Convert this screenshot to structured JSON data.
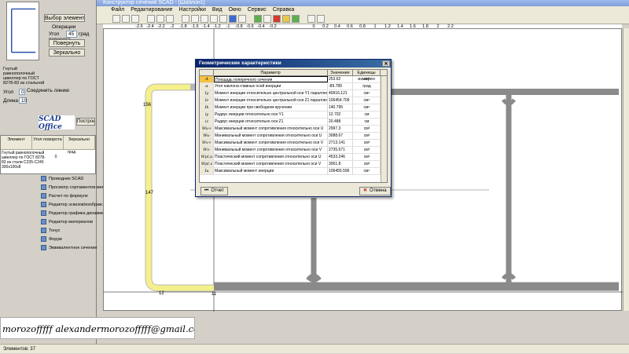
{
  "window": {
    "title": "Конструктор сечений SCAD - [Шаблон1]"
  },
  "menu": [
    "Файл",
    "Редактирование",
    "Настройки",
    "Вид",
    "Окно",
    "Сервис",
    "Справка"
  ],
  "left": {
    "select_button": "Выбор элемента",
    "operations_label": "Операции",
    "angle_label": "Угол поворота",
    "angle_value": "45",
    "angle_unit": "град",
    "rotate_button": "Повернуть",
    "mirror_button": "Зеркально",
    "profile_label": "Гнутый равнополочный швеллер по ГОСТ 8278-83 из стальной",
    "connect_label": "Соединить линию",
    "angle2_label": "Угол",
    "angle2_value": "0",
    "length_label": "Длина",
    "length_value": "10",
    "build_button": "Построить",
    "logo": "SCAD Office",
    "table_headers": [
      "Элемент",
      "Угол поворота",
      "Зеркально"
    ],
    "table_unit": "град",
    "table_row_name": "Гнутый равнополочный швеллер по ГОСТ 8278-83 из стали С235-С245 300х100х8",
    "table_row_angle": "0",
    "tree": [
      "Проводник SCAD",
      "Просмотр сортаментов метал",
      "Расчет по формуле",
      "Редактор эскизов/изображ.",
      "Редактор графика динамики",
      "Редактор материалов",
      "Тонус",
      "Форум",
      "Эквивалентное сечение"
    ]
  },
  "ruler": [
    "-2.6",
    "-2.4",
    "-2.2",
    "-2",
    "-1.8",
    "-1.6",
    "-1.4",
    "-1.2",
    "-1",
    "-0.8",
    "-0.6",
    "-0.4",
    "-0.2",
    "0",
    "0.2",
    "0.4",
    "0.6",
    "0.8",
    "1",
    "1.2",
    "1.4",
    "1.6",
    "1.8",
    "2",
    "2.2"
  ],
  "drawing": {
    "labels": [
      "156",
      "147",
      "12",
      "11"
    ]
  },
  "dialog": {
    "title": "Геометрические характеристики",
    "headers": [
      "",
      "Параметр",
      "Значение",
      "Единицы измерен"
    ],
    "rows": [
      {
        "sym": "A",
        "param": "Площадь поперечного сечения",
        "value": "253.62",
        "unit": "см²"
      },
      {
        "sym": "α",
        "param": "Угол наклона главных осей инерции",
        "value": "-89.789",
        "unit": "град"
      },
      {
        "sym": "Iy",
        "param": "Момент инерции относительно центральной оси Y1 параллельной оси Y",
        "value": "40916.121",
        "unit": "см⁴"
      },
      {
        "sym": "Iz",
        "param": "Момент инерции относительно центральной оси Z1 параллельной оси Z",
        "value": "106454.709",
        "unit": "см⁴"
      },
      {
        "sym": "Ik",
        "param": "Момент инерции при свободном кручении",
        "value": "140.795",
        "unit": "см⁴"
      },
      {
        "sym": "iy",
        "param": "Радиус инерции относительно оси Y1",
        "value": "12.702",
        "unit": "см"
      },
      {
        "sym": "iz",
        "param": "Радиус инерции относительно оси Z1",
        "value": "20.488",
        "unit": "см"
      },
      {
        "sym": "Wu+",
        "param": "Максимальный момент сопротивления относительно оси U",
        "value": "2997.3",
        "unit": "см³"
      },
      {
        "sym": "Wu-",
        "param": "Минимальный момент сопротивления относительно оси U",
        "value": "3088.67",
        "unit": "см³"
      },
      {
        "sym": "Wv+",
        "param": "Максимальный момент сопротивления относительно оси V",
        "value": "2713.141",
        "unit": "см³"
      },
      {
        "sym": "Wv-",
        "param": "Минимальный момент сопротивления относительно оси V",
        "value": "2735.671",
        "unit": "см³"
      },
      {
        "sym": "Wpl,u",
        "param": "Пластический момент сопротивления относительно оси U",
        "value": "4533.246",
        "unit": "см³"
      },
      {
        "sym": "Wpl,v",
        "param": "Пластический момент сопротивления относительно оси V",
        "value": "3061.8",
        "unit": "см³"
      },
      {
        "sym": "Iu",
        "param": "Максимальный момент инерции",
        "value": "106455.596",
        "unit": "см⁴"
      }
    ],
    "report_button": "Отчет",
    "cancel_button": "Отмена"
  },
  "email": "morozofffff alexandermorozofffff@gmail.com",
  "status": "Элементов: 37"
}
